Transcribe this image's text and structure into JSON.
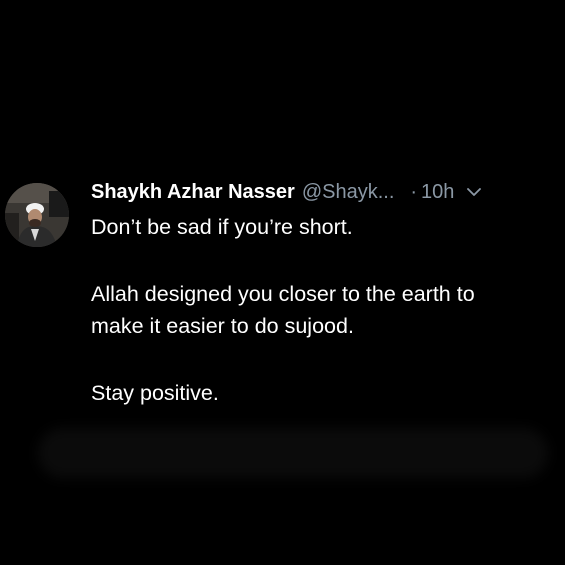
{
  "tweet": {
    "display_name": "Shaykh Azhar Nasser",
    "handle": "@Shayk...",
    "separator": "·",
    "time": "10h",
    "lines": [
      "Don’t be sad if you’re short.",
      "Allah designed you closer to the earth to",
      "make it easier to do sujood.",
      "Stay positive."
    ]
  },
  "icons": {
    "avatar": "profile-photo",
    "menu": "chevron-down-icon"
  },
  "colors": {
    "background": "#000000",
    "text_primary": "#ffffff",
    "text_secondary": "#8b98a5"
  }
}
